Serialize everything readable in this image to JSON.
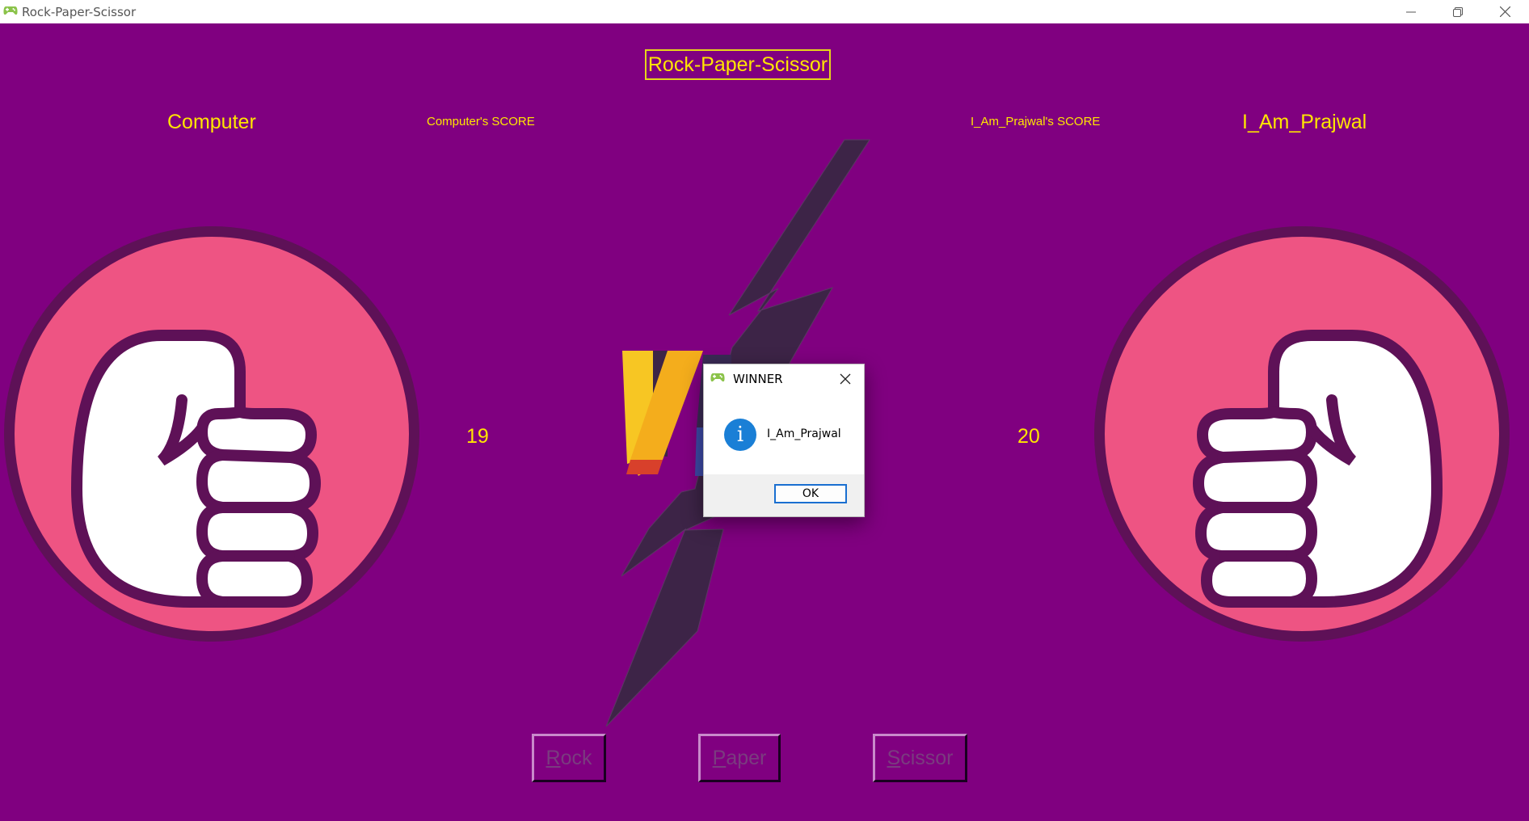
{
  "window": {
    "title": "Rock-Paper-Scissor",
    "minimize_icon": "minimize-icon",
    "restore_icon": "restore-icon",
    "close_icon": "close-icon"
  },
  "game": {
    "heading": "Rock-Paper-Scissor",
    "left_player": {
      "name": "Computer",
      "score_label": "Computer's SCORE",
      "score": "19",
      "choice_icon": "rock-fist-icon"
    },
    "right_player": {
      "name": "I_Am_Prajwal",
      "score_label": "I_Am_Prajwal's SCORE",
      "score": "20",
      "choice_icon": "rock-fist-icon"
    },
    "buttons": [
      {
        "label_first": "R",
        "label_rest": "ock"
      },
      {
        "label_first": "P",
        "label_rest": "aper"
      },
      {
        "label_first": "S",
        "label_rest": "cissor"
      }
    ],
    "vs_icon": "versus-icon"
  },
  "dialog": {
    "title": "WINNER",
    "message": "I_Am_Prajwal",
    "ok_label": "OK",
    "icon": "info-icon"
  },
  "colors": {
    "background": "#800080",
    "accent_yellow": "#ffe600",
    "circle_pink": "#ee5483",
    "circle_ring": "#5e1157",
    "bolt": "#3d2447"
  }
}
